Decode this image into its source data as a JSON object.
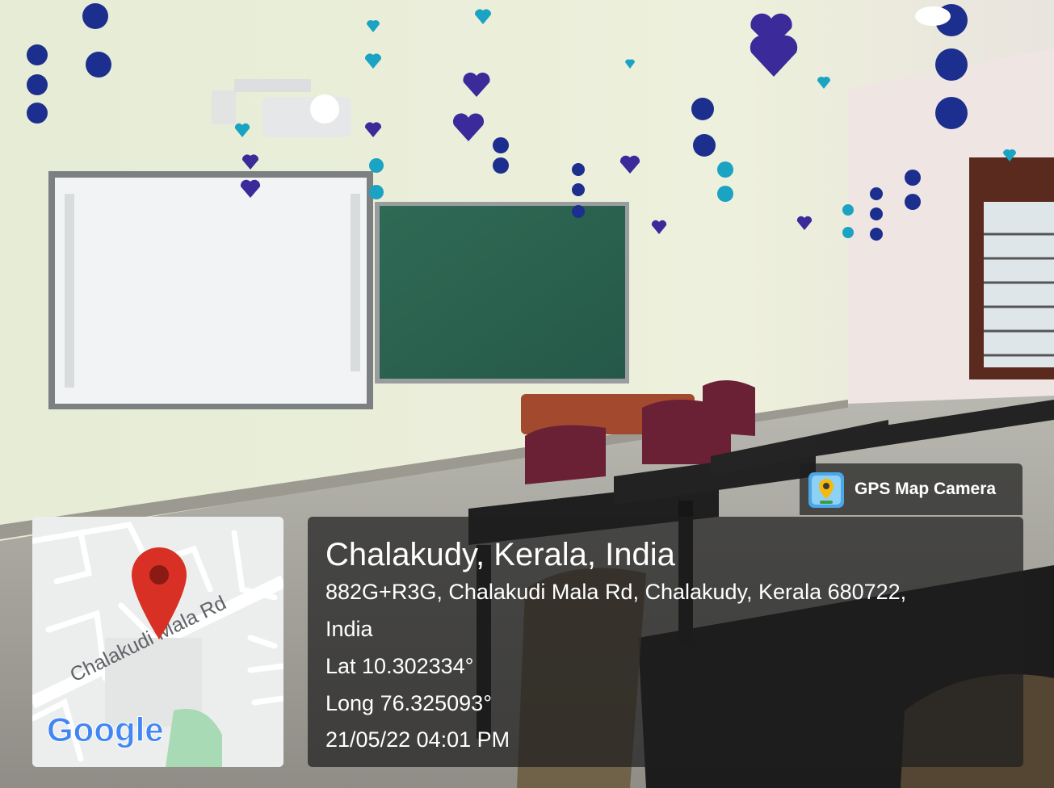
{
  "badge": {
    "label": "GPS Map Camera",
    "icon": "camera-pin-icon"
  },
  "map": {
    "road_label": "Chalakudi Mala Rd",
    "logo": "Google",
    "pin_color": "#d93025"
  },
  "location": {
    "title": "Chalakudy, Kerala, India",
    "address_line1": "882G+R3G, Chalakudi Mala Rd, Chalakudy, Kerala 680722,",
    "address_line2": "India",
    "lat": "Lat 10.302334°",
    "long": "Long 76.325093°",
    "datetime": "21/05/22 04:01 PM"
  }
}
